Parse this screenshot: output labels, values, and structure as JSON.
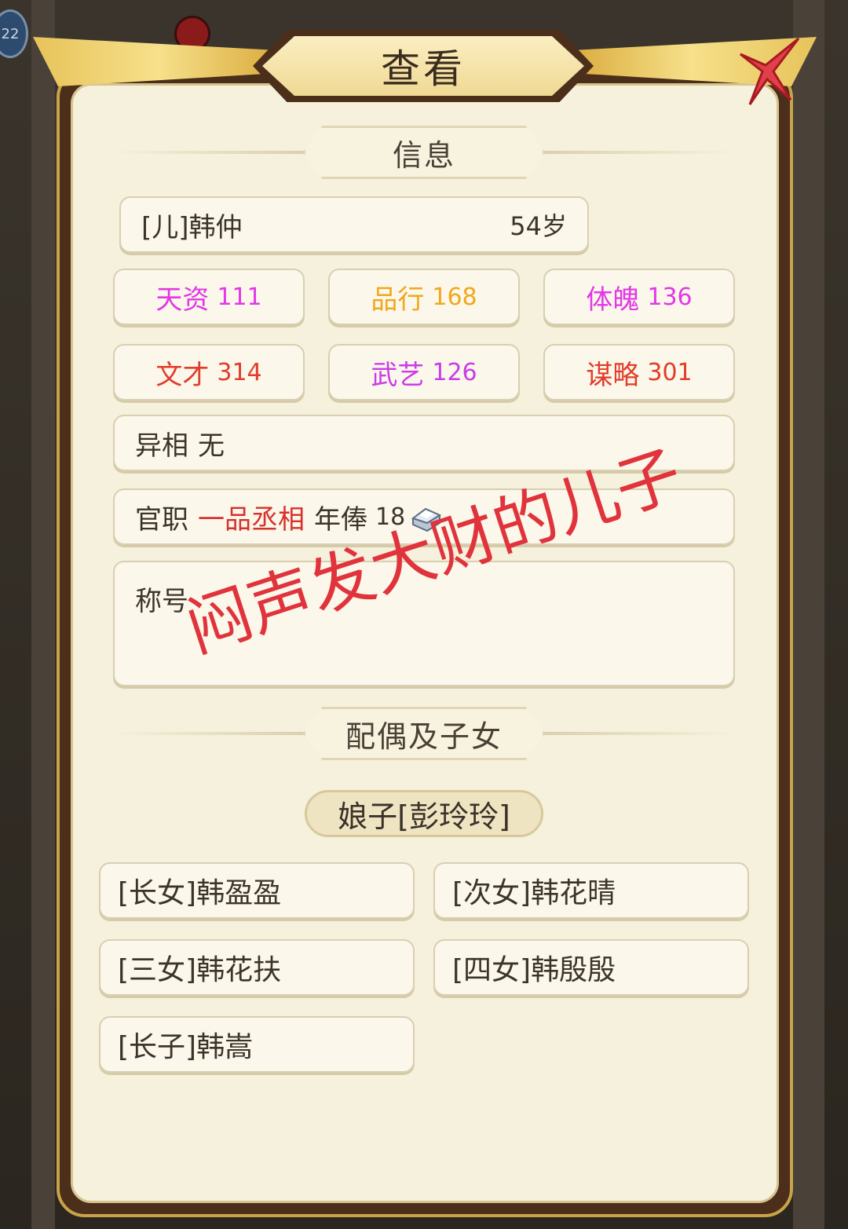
{
  "header": {
    "title": "查看",
    "badge": "22"
  },
  "info_section": {
    "label": "信息"
  },
  "person": {
    "name": "[儿]韩仲",
    "age": "54岁"
  },
  "stats": [
    {
      "label": "天资",
      "value": "111",
      "color": "#e238e6"
    },
    {
      "label": "品行",
      "value": "168",
      "color": "#f0a81c"
    },
    {
      "label": "体魄",
      "value": "136",
      "color": "#e238e6"
    },
    {
      "label": "文才",
      "value": "314",
      "color": "#e23c2a"
    },
    {
      "label": "武艺",
      "value": "126",
      "color": "#c93ce8"
    },
    {
      "label": "谋略",
      "value": "301",
      "color": "#e23c2a"
    }
  ],
  "trait": {
    "label": "异相",
    "value": "无"
  },
  "office": {
    "label": "官职",
    "rank": "一品丞相",
    "salary_label": "年俸",
    "salary": "18",
    "rank_color": "#d7312c"
  },
  "title_field": {
    "label": "称号"
  },
  "watermark": "闷声发大财的儿子",
  "family_section": {
    "label": "配偶及子女"
  },
  "spouse": {
    "label": "娘子[彭玲玲]"
  },
  "children": [
    "[长女]韩盈盈",
    "[次女]韩花晴",
    "[三女]韩花扶",
    "[四女]韩殷殷",
    "[长子]韩嵩"
  ]
}
